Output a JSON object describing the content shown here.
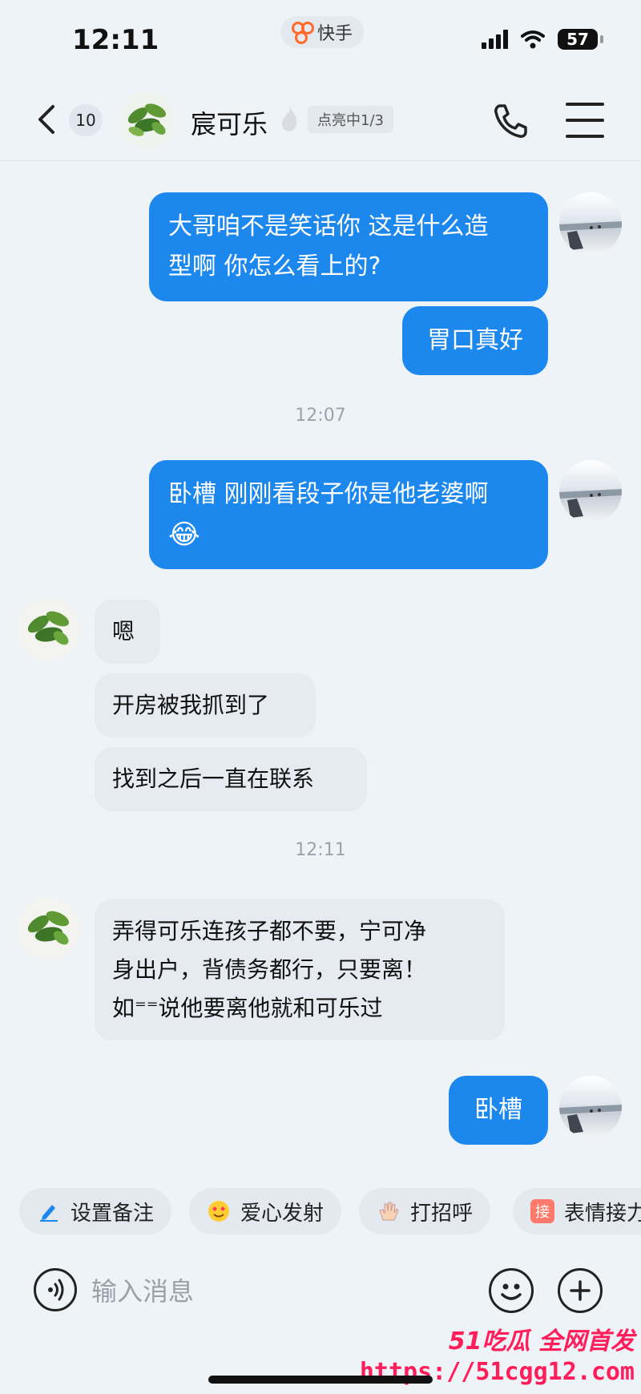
{
  "status_bar": {
    "time": "12:11",
    "app_name": "快手",
    "battery": "57"
  },
  "header": {
    "unread_count": "10",
    "contact_name": "宸可乐",
    "light_badge": "点亮中1/3"
  },
  "messages": [
    {
      "side": "out",
      "text_lines": [
        "大哥咱不是笑话你 这是什么造",
        "型啊 你怎么看上的?"
      ]
    },
    {
      "side": "out",
      "text": "胃口真好"
    },
    {
      "side": "time",
      "text": "12:07"
    },
    {
      "side": "out",
      "text": "卧槽 刚刚看段子你是他老婆啊",
      "emoji": "😂"
    },
    {
      "side": "in",
      "text": "嗯"
    },
    {
      "side": "in",
      "text": "开房被我抓到了"
    },
    {
      "side": "in",
      "text": "找到之后一直在联系"
    },
    {
      "side": "time",
      "text": "12:11"
    },
    {
      "side": "in",
      "text_lines": [
        "弄得可乐连孩子都不要，宁可净",
        "身出户，背债务都行，只要离！",
        "如⁼⁼说他要离他就和可乐过"
      ]
    },
    {
      "side": "out",
      "text": "卧槽"
    }
  ],
  "quick_actions": [
    {
      "label": "设置备注",
      "icon": "pencil-icon"
    },
    {
      "label": "爱心发射",
      "icon": "heart-eyes-icon"
    },
    {
      "label": "打招呼",
      "icon": "wave-hand-icon"
    },
    {
      "label": "表情接力",
      "icon": "relay-icon",
      "icon_text": "接"
    }
  ],
  "input": {
    "placeholder": "输入消息"
  },
  "watermark": {
    "line1": "51吃瓜 全网首发",
    "line2": "https://51cgg12.com"
  },
  "colors": {
    "bubble_out": "#1c88ee",
    "bubble_in": "#e6ebf1",
    "background": "#eef3f8",
    "watermark": "#ff1e5a"
  }
}
